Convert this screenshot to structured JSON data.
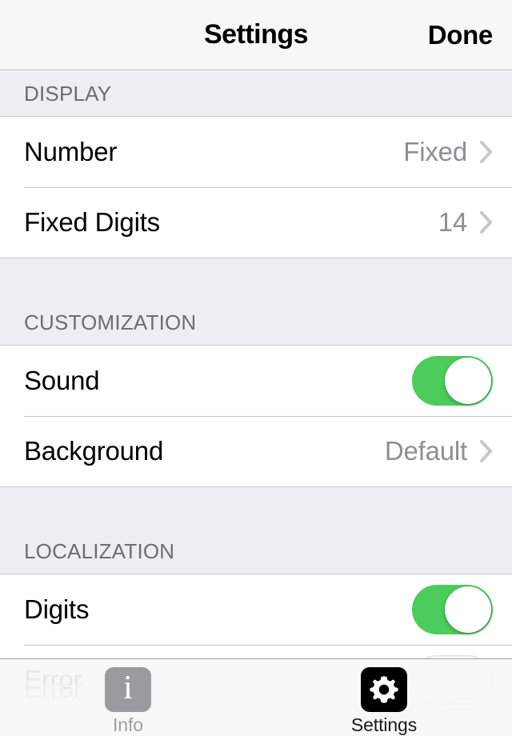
{
  "navbar": {
    "title": "Settings",
    "done_label": "Done"
  },
  "sections": [
    {
      "header": "DISPLAY",
      "rows": [
        {
          "title": "Number",
          "value": "Fixed",
          "accessory": "chevron"
        },
        {
          "title": "Fixed Digits",
          "value": "14",
          "accessory": "chevron"
        }
      ]
    },
    {
      "header": "CUSTOMIZATION",
      "rows": [
        {
          "title": "Sound",
          "value": "",
          "accessory": "switch-on"
        },
        {
          "title": "Background",
          "value": "Default",
          "accessory": "chevron"
        }
      ]
    },
    {
      "header": "LOCALIZATION",
      "rows": [
        {
          "title": "Digits",
          "value": "",
          "accessory": "switch-on"
        },
        {
          "title": "Error",
          "value": "",
          "accessory": "switch-off"
        }
      ]
    }
  ],
  "tabbar": {
    "watermark": "Error",
    "tabs": [
      {
        "label": "Info",
        "icon": "info-icon",
        "active": false
      },
      {
        "label": "Settings",
        "icon": "gear-icon",
        "active": true
      }
    ]
  },
  "colors": {
    "switch_on": "#4CCC5B",
    "section_header_bg": "#EDEDF2",
    "separator": "#C8C7CC",
    "value_text": "#8E8E93",
    "header_text": "#6D6D72",
    "navbar_bg": "#F7F7F8",
    "tabbar_bg": "#F8F8F8",
    "info_icon_bg": "#9B9B9F",
    "settings_icon_bg": "#000000"
  }
}
